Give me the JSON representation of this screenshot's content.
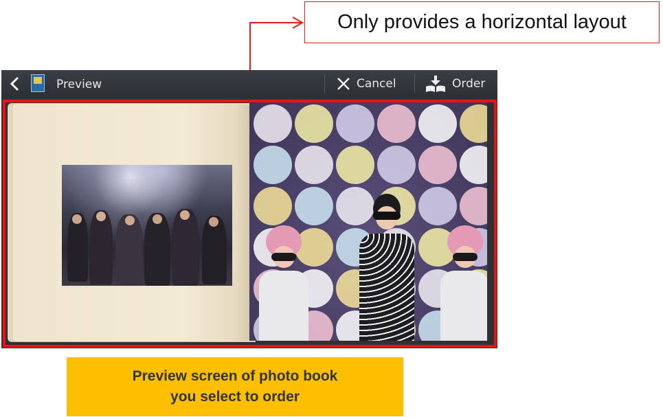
{
  "callout": {
    "text": "Only provides a horizontal layout"
  },
  "actionbar": {
    "title": "Preview",
    "cancel_label": "Cancel",
    "order_label": "Order",
    "icons": [
      "back-arrow-icon",
      "photobook-app-icon",
      "close-icon",
      "order-book-icon"
    ]
  },
  "caption": {
    "line1": "Preview screen of photo book",
    "line2": "you select to order"
  },
  "colors": {
    "highlight": "#ee1111",
    "caption_bg": "#fdbf00",
    "actionbar_bg": "#2c2f34",
    "page_paper": "#f3ead6"
  }
}
